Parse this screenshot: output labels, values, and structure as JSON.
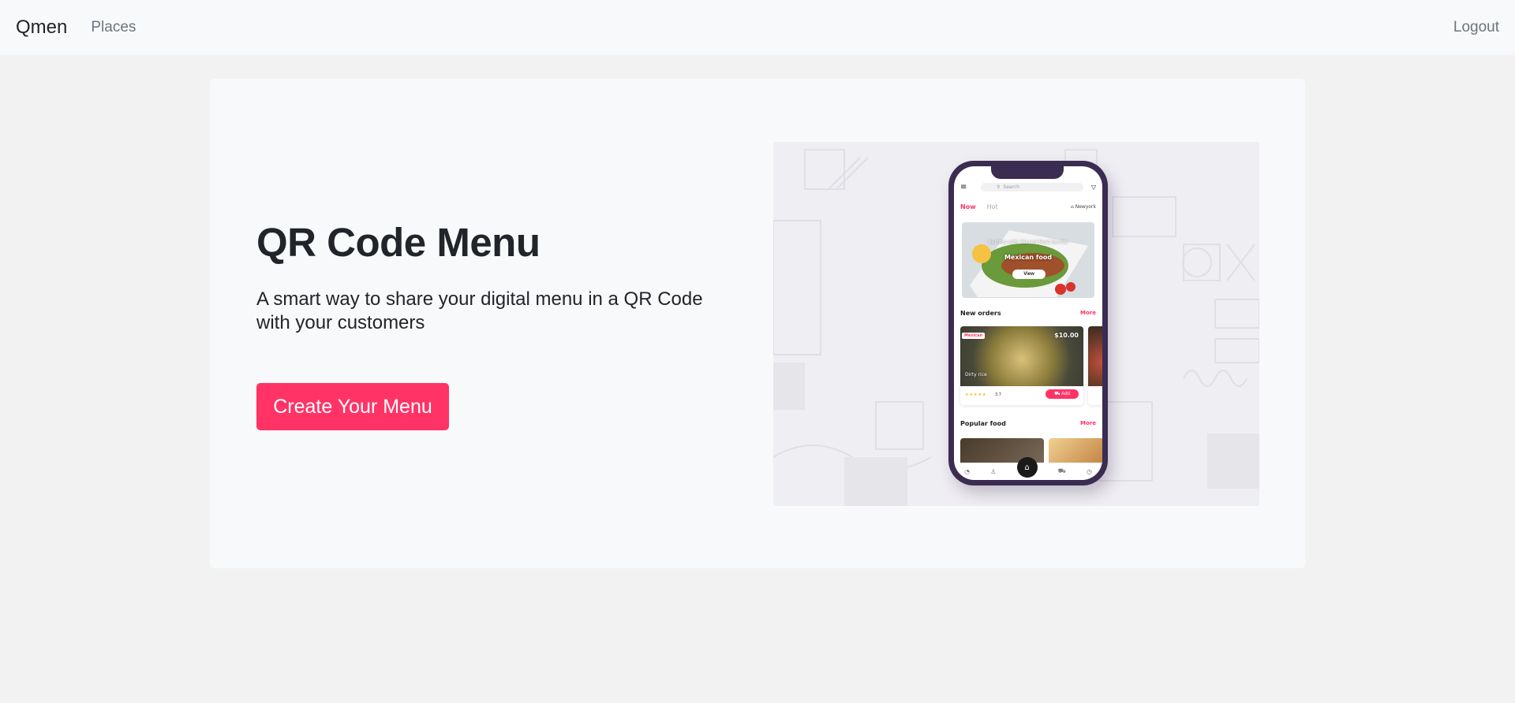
{
  "nav": {
    "brand": "Qmen",
    "places": "Places",
    "logout": "Logout"
  },
  "hero": {
    "title": "QR Code Menu",
    "subtitle": "A smart way to share your digital menu in a QR Code with your customers",
    "cta": "Create Your Menu"
  },
  "phone": {
    "search_placeholder": "Search",
    "tab_now": "Now",
    "tab_hot": "Hot",
    "location": "Newyork",
    "hero_caption": "Burritos with Minced Meat Burrito",
    "hero_title": "Mexican food",
    "hero_button": "View",
    "new_orders_title": "New orders",
    "new_orders_more": "More",
    "order_tag": "Mexican",
    "order_price": "$10.00",
    "order_name": "Dirty rice",
    "order_rating": "3.7",
    "order_add": "Add",
    "popular_title": "Popular food",
    "popular_more": "More"
  },
  "colors": {
    "accent": "#ff3366",
    "phone_frame": "#3b2c52",
    "navbar_bg": "#f8f9fa",
    "page_bg": "#f2f2f2"
  },
  "icons": [
    "menu-icon",
    "search-icon",
    "filter-icon",
    "location-icon",
    "cart-icon",
    "home-icon"
  ]
}
